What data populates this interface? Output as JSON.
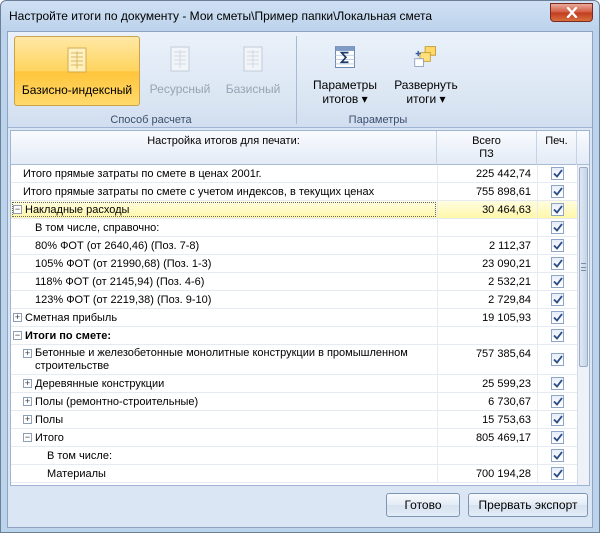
{
  "window": {
    "title": "Настройте итоги по документу - Мои сметы\\Пример папки\\Локальная смета"
  },
  "ribbon": {
    "calc_group_label": "Способ расчета",
    "params_group_label": "Параметры",
    "btn_base_index": "Базисно-индексный",
    "btn_resource": "Ресурсный",
    "btn_base": "Базисный",
    "btn_params_totals_line1": "Параметры",
    "btn_params_totals_line2": "итогов ▾",
    "btn_expand_totals_line1": "Развернуть",
    "btn_expand_totals_line2": "итоги ▾"
  },
  "grid": {
    "col_name": "Настройка итогов для печати:",
    "col_total_line1": "Всего",
    "col_total_line2": "ПЗ",
    "col_print": "Печ.",
    "rows": [
      {
        "label": "Итого прямые затраты по смете в ценах 2001г.",
        "value": "225 442,74",
        "checked": true
      },
      {
        "label": "Итого прямые затраты по смете с учетом индексов, в текущих ценах",
        "value": "755 898,61",
        "checked": true
      },
      {
        "label": "Накладные расходы",
        "value": "30 464,63",
        "checked": true
      },
      {
        "label": "В том числе, справочно:",
        "value": "",
        "checked": true
      },
      {
        "label": "80% ФОТ (от 2640,46) (Поз. 7-8)",
        "value": "2 112,37",
        "checked": true
      },
      {
        "label": "105% ФОТ (от 21990,68) (Поз. 1-3)",
        "value": "23 090,21",
        "checked": true
      },
      {
        "label": "118% ФОТ (от 2145,94) (Поз. 4-6)",
        "value": "2 532,21",
        "checked": true
      },
      {
        "label": "123% ФОТ (от 2219,38) (Поз. 9-10)",
        "value": "2 729,84",
        "checked": true
      },
      {
        "label": "Сметная прибыль",
        "value": "19 105,93",
        "checked": true
      },
      {
        "label": "Итоги по смете:",
        "value": "",
        "checked": true
      },
      {
        "label": "Бетонные и железобетонные монолитные конструкции в промышленном",
        "label2": "строительстве",
        "value": "757 385,64",
        "checked": true
      },
      {
        "label": "Деревянные конструкции",
        "value": "25 599,23",
        "checked": true
      },
      {
        "label": "Полы (ремонтно-строительные)",
        "value": "6 730,67",
        "checked": true
      },
      {
        "label": "Полы",
        "value": "15 753,63",
        "checked": true
      },
      {
        "label": "Итого",
        "value": "805 469,17",
        "checked": true
      },
      {
        "label": "В том числе:",
        "value": "",
        "checked": true
      },
      {
        "label": "Материалы",
        "value": "700 194,28",
        "checked": true
      }
    ]
  },
  "footer": {
    "ok_label": "Готово",
    "abort_label": "Прервать экспорт"
  },
  "colors": {
    "selected_row": "#fff7a8",
    "active_button": "#ffd45e",
    "check_mark": "#2a4a86"
  }
}
